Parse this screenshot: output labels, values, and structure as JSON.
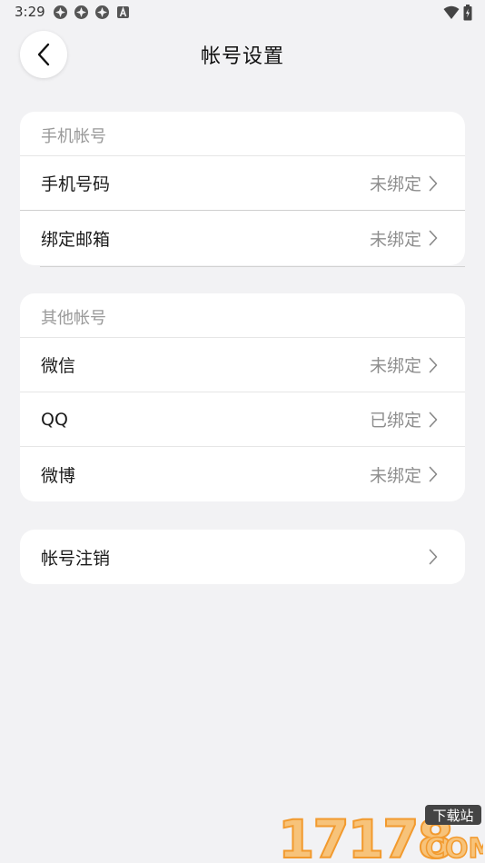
{
  "status_bar": {
    "time": "3:29",
    "notification_icons": [
      "app-icon",
      "app-icon",
      "app-icon",
      "a-icon"
    ],
    "right_icons": [
      "wifi-icon",
      "battery-icon"
    ]
  },
  "header": {
    "title": "帐号设置",
    "back_icon": "chevron-left-icon"
  },
  "section_phone": {
    "header": "手机帐号",
    "rows": [
      {
        "label": "手机号码",
        "value": "未绑定"
      },
      {
        "label": "绑定邮箱",
        "value": "未绑定"
      }
    ]
  },
  "section_other": {
    "header": "其他帐号",
    "rows": [
      {
        "label": "微信",
        "value": "未绑定"
      },
      {
        "label": "QQ",
        "value": "已绑定"
      },
      {
        "label": "微博",
        "value": "未绑定"
      }
    ]
  },
  "section_cancel": {
    "rows": [
      {
        "label": "帐号注销",
        "value": ""
      }
    ]
  },
  "watermark": {
    "number": "17178",
    "badge": "下载站",
    "domain": "COM"
  },
  "colors": {
    "background": "#f2f2f4",
    "card": "#ffffff",
    "value_text": "#8e8e8e",
    "header_text": "#999999",
    "watermark_orange": "#f29a2e"
  }
}
